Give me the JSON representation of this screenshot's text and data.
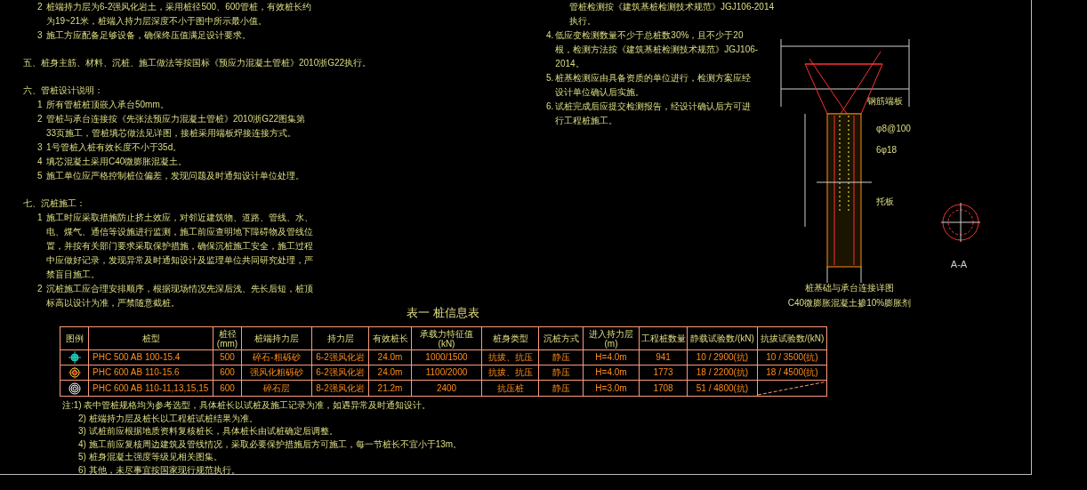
{
  "left_notes": [
    {
      "kind": "item",
      "number": "2",
      "text": "桩端持力层为6-2强风化岩土，采用桩径500、600管桩，有效桩长约为19~21米，桩端入持力层深度不小于图中所示最小值。"
    },
    {
      "kind": "item",
      "number": "3",
      "text": "施工方应配备足够设备，确保终压值满足设计要求。"
    },
    {
      "kind": "heading",
      "text": "五、桩身主筋、材料、沉桩、施工做法等按国标《预应力混凝土管桩》2010浙G22执行。"
    },
    {
      "kind": "heading",
      "text": "六、管桩设计说明："
    },
    {
      "kind": "item",
      "number": "1",
      "text": "所有管桩桩顶嵌入承台50mm。"
    },
    {
      "kind": "item",
      "number": "2",
      "text": "管桩与承台连接按《先张法预应力混凝土管桩》2010浙G22图集第33页施工，管桩填芯做法见详图，接桩采用端板焊接连接方式。"
    },
    {
      "kind": "item",
      "number": "3",
      "text": "1号管桩入桩有效长度不小于35d。"
    },
    {
      "kind": "item",
      "number": "4",
      "text": "填芯混凝土采用C40微膨胀混凝土。"
    },
    {
      "kind": "item",
      "number": "5",
      "text": "施工单位应严格控制桩位偏差，发现问题及时通知设计单位处理。"
    },
    {
      "kind": "heading",
      "text": "七、沉桩施工："
    },
    {
      "kind": "item",
      "number": "1",
      "text": "施工时应采取措施防止挤土效应，对邻近建筑物、道路、管线、水、电、煤气、通信等设施进行监测，施工前应查明地下障碍物及管线位置，并按有关部门要求采取保护措施，确保沉桩施工安全，施工过程中应做好记录，发现异常及时通知设计及监理单位共同研究处理，严禁盲目施工。"
    },
    {
      "kind": "item",
      "number": "2",
      "text": "沉桩施工应合理安排顺序，根据现场情况先深后浅、先长后短，桩顶标高以设计为准，严禁随意截桩。"
    }
  ],
  "right_notes": [
    {
      "kind": "continuation",
      "text": "管桩检测按《建筑基桩检测技术规范》JGJ106-2014执行。"
    },
    {
      "kind": "item",
      "number": "4.",
      "text": "低应变检测数量不少于总桩数30%，且不少于20根，检测方法按《建筑基桩检测技术规范》JGJ106-2014。"
    },
    {
      "kind": "item",
      "number": "5.",
      "text": "桩基检测应由具备资质的单位进行，检测方案应经设计单位确认后实施。"
    },
    {
      "kind": "item",
      "number": "6.",
      "text": "试桩完成后应提交检测报告，经设计确认后方可进行工程桩施工。"
    }
  ],
  "table": {
    "title": "表一  桩信息表",
    "columns": [
      "图例",
      "桩型",
      "桩径(mm)",
      "桩端持力层",
      "持力层",
      "有效桩长",
      "承载力特征值(kN)",
      "桩身类型",
      "沉桩方式",
      "进入持力层(m)",
      "工程桩数量",
      "静载试验数/(kN)",
      "抗拔试验数/(kN)"
    ],
    "rows": [
      {
        "kind": "cross-target",
        "struck_last": false,
        "cells": [
          "",
          "PHC 500 AB 100-15.4",
          "500",
          "碎石-粗砾砂",
          "6-2强风化岩",
          "24.0m",
          "1000/1500",
          "抗拔、抗压",
          "静压",
          "H=4.0m",
          "941",
          "10 / 2900(抗)",
          "10 / 3500(抗)"
        ]
      },
      {
        "kind": "crosshair",
        "struck_last": false,
        "cells": [
          "",
          "PHC 600 AB 110-15.6",
          "600",
          "强风化粗砾砂",
          "6-2强风化岩",
          "24.0m",
          "1100/2000",
          "抗拔、抗压",
          "静压",
          "H=4.0m",
          "1773",
          "18 / 2200(抗)",
          "18 / 4500(抗)"
        ]
      },
      {
        "kind": "rings",
        "struck_last": true,
        "cells": [
          "",
          "PHC 600 AB 110-11,13,15,15",
          "600",
          "碎石层",
          "8-2强风化岩",
          "21.2m",
          "2400",
          "抗压桩",
          "静压",
          "H=3.0m",
          "1708",
          "51 / 4800(抗)"
        ]
      }
    ],
    "notes": [
      "注:1) 表中管桩规格均为参考选型，具体桩长以试桩及施工记录为准，如遇异常及时通知设计。",
      "2) 桩端持力层及桩长以工程桩试桩结果为准。",
      "3) 试桩前应根据地质资料复核桩长，具体桩长由试桩确定后调整。",
      "4) 施工前应复核周边建筑及管线情况，采取必要保护措施后方可施工，每一节桩长不宜小于13m。",
      "5) 桩身混凝土强度等级见相关图集。",
      "6) 其他，未尽事宜按国家现行规范执行。"
    ]
  },
  "detail": {
    "title": "桩基础与承台连接详图",
    "subtitle": "C40微膨胀混凝土掺10%膨胀剂",
    "section_label": "A-A",
    "labels": [
      "钢筋端板",
      "φ8@100",
      "6φ18",
      "托板"
    ]
  }
}
